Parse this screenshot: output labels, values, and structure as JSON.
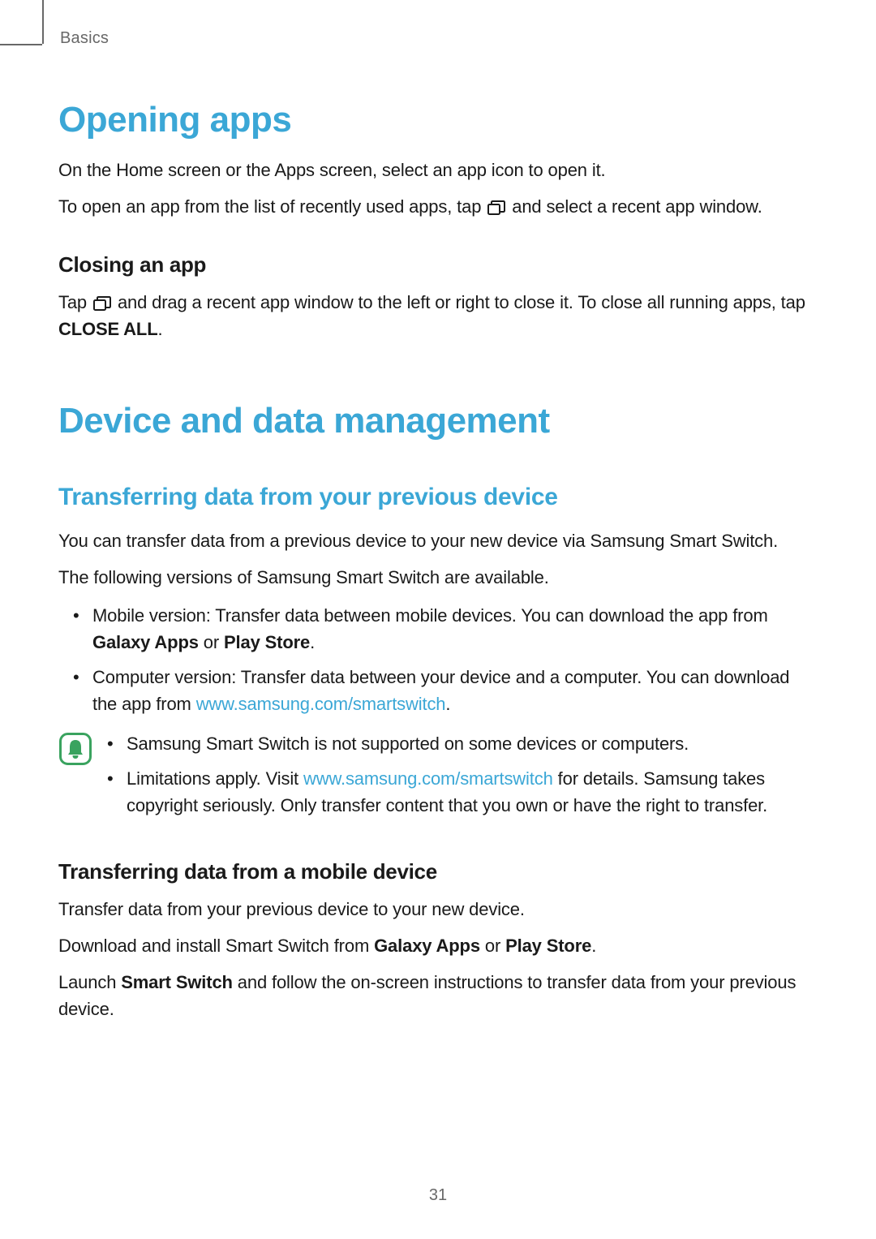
{
  "breadcrumb": "Basics",
  "section1": {
    "title": "Opening apps",
    "p1": "On the Home screen or the Apps screen, select an app icon to open it.",
    "p2a": "To open an app from the list of recently used apps, tap ",
    "p2b": " and select a recent app window.",
    "sub1": {
      "title": "Closing an app",
      "p1a": "Tap ",
      "p1b": " and drag a recent app window to the left or right to close it. To close all running apps, tap ",
      "p1c": "CLOSE ALL",
      "p1d": "."
    }
  },
  "section2": {
    "title": "Device and data management",
    "sub1": {
      "title": "Transferring data from your previous device",
      "p1": "You can transfer data from a previous device to your new device via Samsung Smart Switch.",
      "p2": "The following versions of Samsung Smart Switch are available.",
      "li1a": "Mobile version: Transfer data between mobile devices. You can download the app from ",
      "li1b": "Galaxy Apps",
      "li1c": " or ",
      "li1d": "Play Store",
      "li1e": ".",
      "li2a": "Computer version: Transfer data between your device and a computer. You can download the app from ",
      "li2link": "www.samsung.com/smartswitch",
      "li2b": ".",
      "note_li1": "Samsung Smart Switch is not supported on some devices or computers.",
      "note_li2a": "Limitations apply. Visit ",
      "note_li2link": "www.samsung.com/smartswitch",
      "note_li2b": " for details. Samsung takes copyright seriously. Only transfer content that you own or have the right to transfer."
    },
    "sub2": {
      "title": "Transferring data from a mobile device",
      "p1": "Transfer data from your previous device to your new device.",
      "p2a": "Download and install Smart Switch from ",
      "p2b": "Galaxy Apps",
      "p2c": " or ",
      "p2d": "Play Store",
      "p2e": ".",
      "p3a": "Launch ",
      "p3b": "Smart Switch",
      "p3c": " and follow the on-screen instructions to transfer data from your previous device."
    }
  },
  "page_number": "31"
}
